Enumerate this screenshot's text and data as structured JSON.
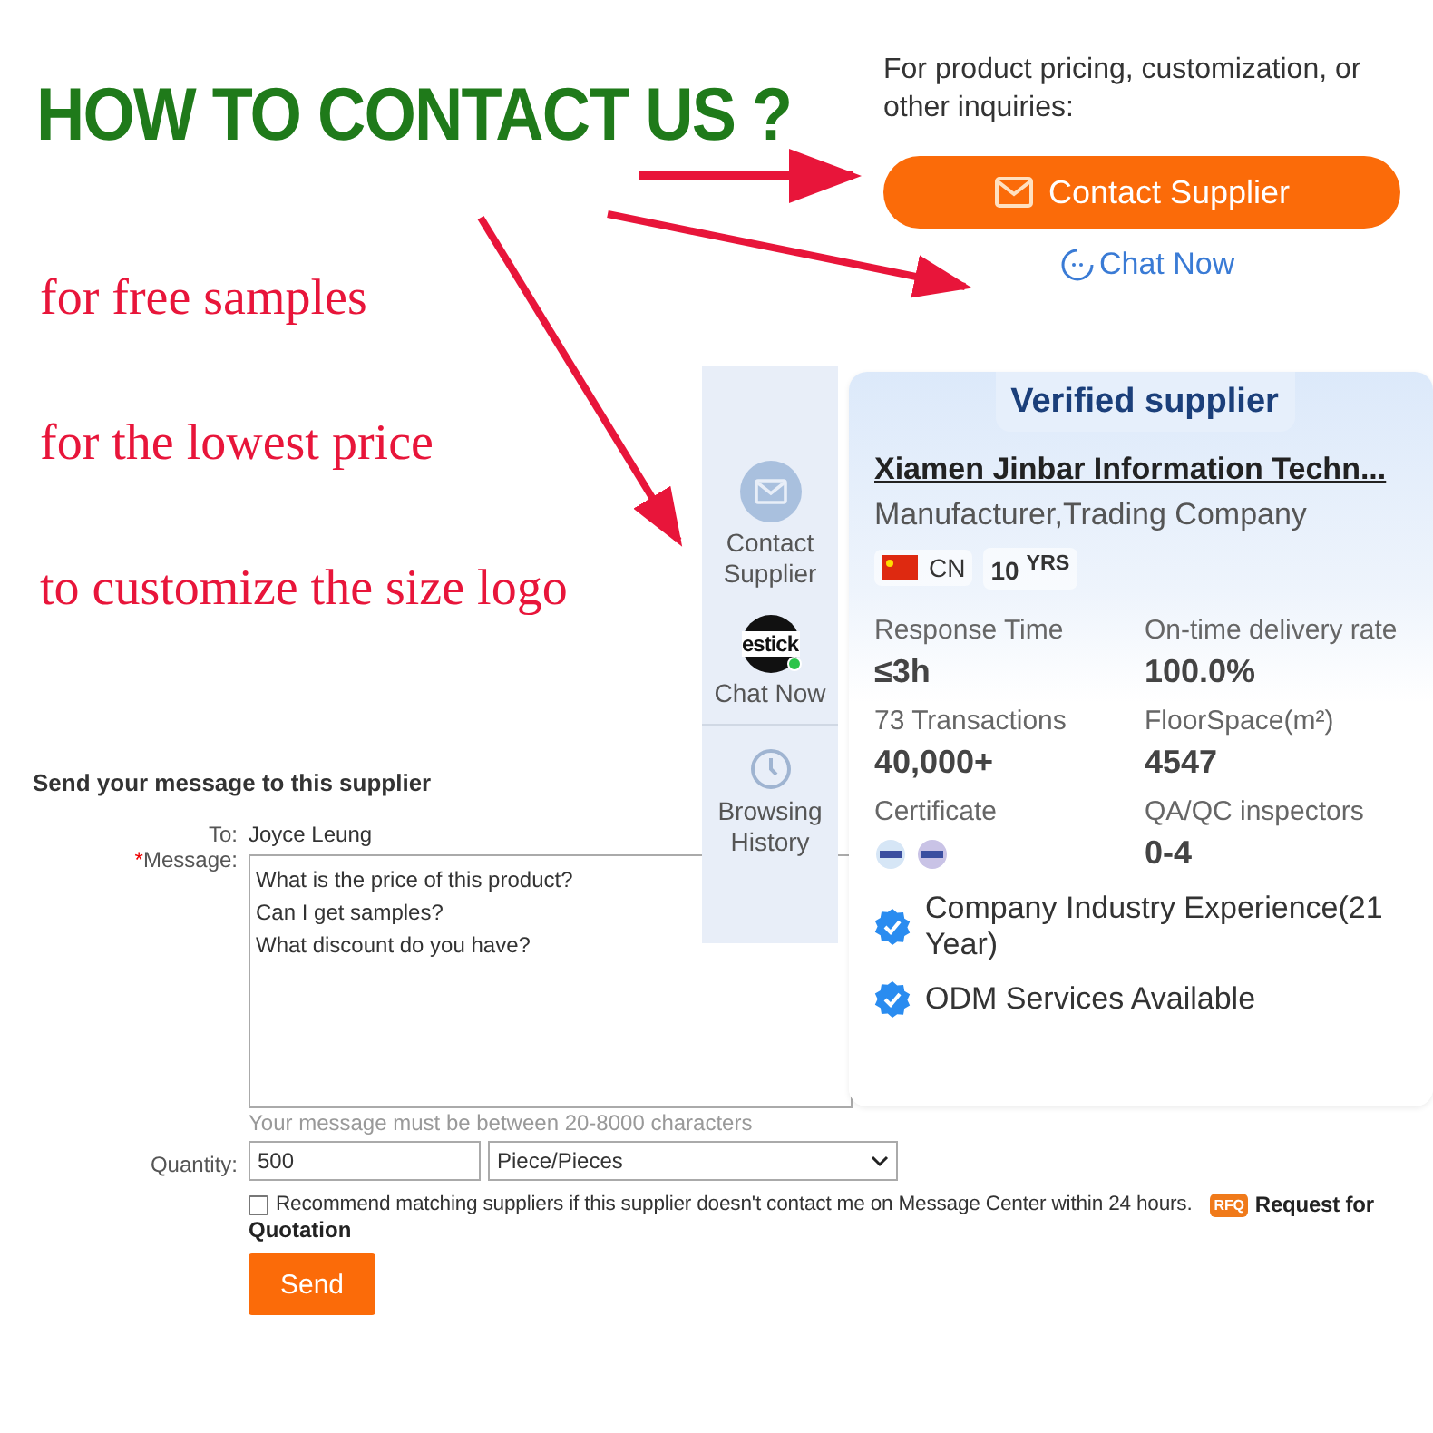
{
  "headline": "HOW TO CONTACT US ?",
  "benefits": [
    "for free samples",
    "for the lowest price",
    "to customize the size logo"
  ],
  "contact_box": {
    "prompt": "For product pricing, customization, or other inquiries:",
    "contact_button": "Contact Supplier",
    "chat_link": "Chat Now"
  },
  "side_panel": {
    "items": [
      {
        "kind": "mail",
        "label": "Contact Supplier"
      },
      {
        "kind": "avatar",
        "avatar_text": "estick",
        "online": true,
        "label": "Chat Now"
      },
      {
        "kind": "history",
        "label": "Browsing History"
      }
    ]
  },
  "supplier_card": {
    "badge": "Verified supplier",
    "company": "Xiamen Jinbar Information Techn...",
    "business_type": "Manufacturer,Trading Company",
    "country": "CN",
    "years": "10 $^{YRS}$",
    "stats": [
      {
        "label": "Response Time",
        "value": "≤3h"
      },
      {
        "label": "On-time delivery rate",
        "value": "100.0%"
      },
      {
        "label": "73 Transactions",
        "value": "40,000+"
      },
      {
        "label": "FloorSpace(m²)",
        "value": "4547"
      },
      {
        "label": "Certificate",
        "kind": "certificates"
      },
      {
        "label": "QA/QC inspectors",
        "value": "0-4"
      }
    ],
    "features": [
      "Company Industry Experience(21 Year)",
      "ODM Services Available"
    ]
  },
  "message_form": {
    "title": "Send your message to this supplier",
    "to_label": "To:",
    "to_value": "Joyce Leung",
    "required_mark": "*",
    "message_label": "Message:",
    "message_lines": [
      "What is the price of this product?",
      "Can I get samples?",
      "What discount do you have?"
    ],
    "hint": "Your message must be between 20-8000 characters",
    "quantity_label": "Quantity:",
    "quantity": "500",
    "unit": "Piece/Pieces",
    "recommend": {
      "checked": false,
      "text": "Recommend matching suppliers if this supplier doesn't contact me on Message Center within 24 hours."
    },
    "rfq_badge": "RFQ",
    "rfq_link_1": "Request for",
    "rfq_link_2": "Quotation",
    "send_button": "Send"
  }
}
